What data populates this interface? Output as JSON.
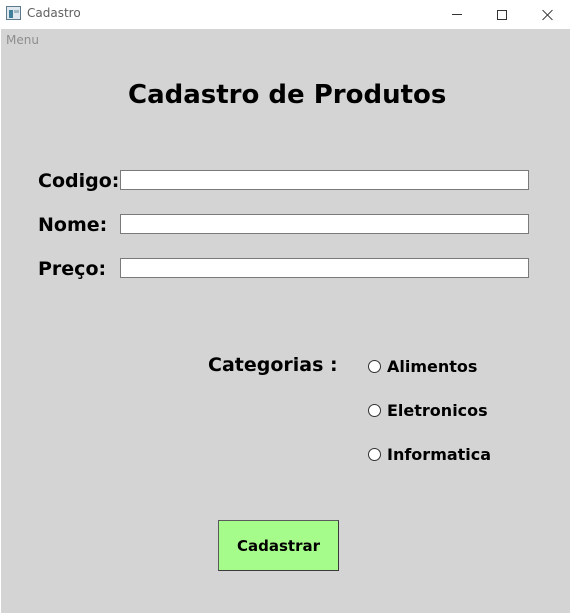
{
  "window": {
    "title": "Cadastro",
    "controls": {
      "minimize_icon": "minimize-icon",
      "maximize_icon": "maximize-icon",
      "close_icon": "close-icon"
    }
  },
  "menu": {
    "label": "Menu"
  },
  "form": {
    "title": "Cadastro de Produtos",
    "fields": [
      {
        "label": "Codigo:",
        "value": ""
      },
      {
        "label": "Nome:",
        "value": ""
      },
      {
        "label": "Preço:",
        "value": ""
      }
    ],
    "categories": {
      "label": "Categorias :",
      "options": [
        {
          "label": "Alimentos",
          "selected": false
        },
        {
          "label": "Eletronicos",
          "selected": false
        },
        {
          "label": "Informatica",
          "selected": false
        }
      ]
    },
    "submit_label": "Cadastrar"
  },
  "colors": {
    "client_background": "#d4d4d4",
    "submit_background": "#a6fc8a"
  }
}
